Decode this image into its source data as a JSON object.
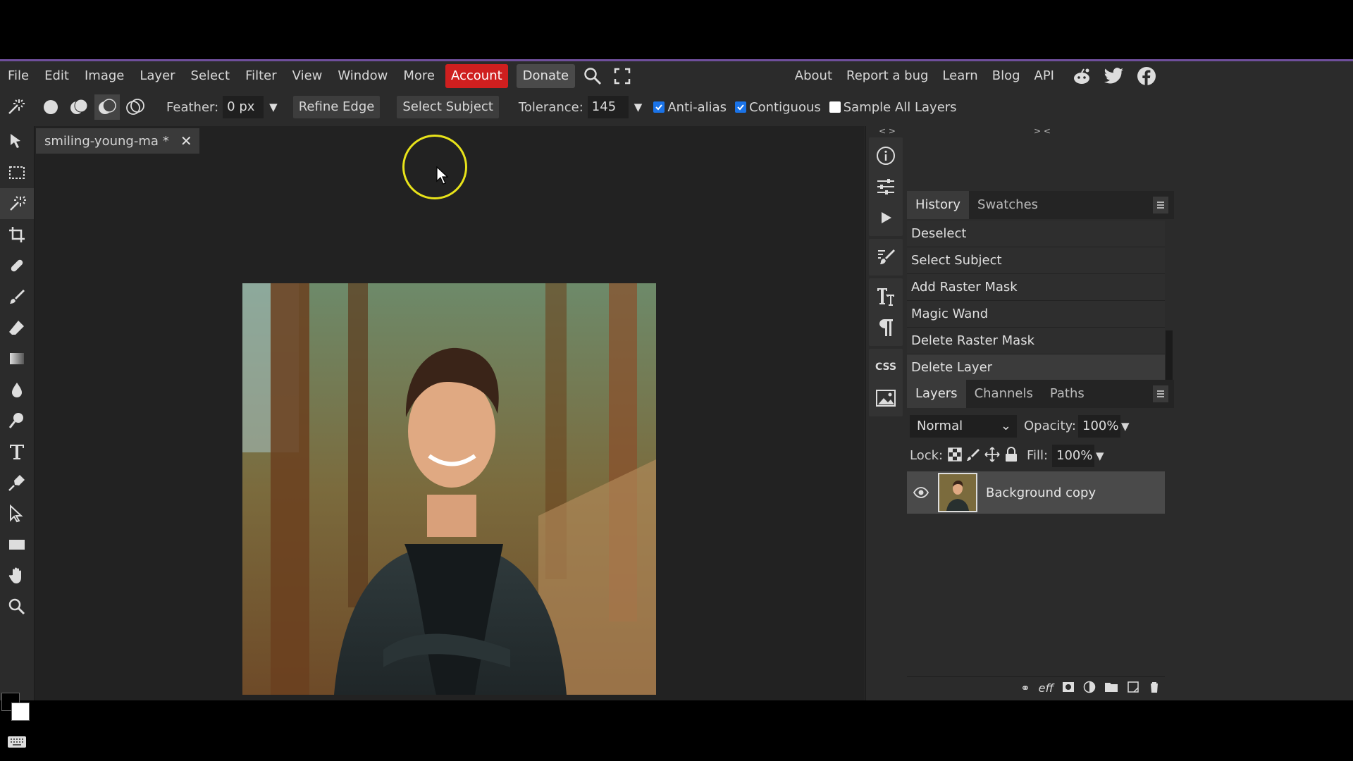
{
  "menu": {
    "items": [
      "File",
      "Edit",
      "Image",
      "Layer",
      "Select",
      "Filter",
      "View",
      "Window",
      "More"
    ],
    "account": "Account",
    "donate": "Donate",
    "right_links": [
      "About",
      "Report a bug",
      "Learn",
      "Blog",
      "API"
    ]
  },
  "options": {
    "feather_label": "Feather:",
    "feather_value": "0 px",
    "refine_edge": "Refine Edge",
    "select_subject": "Select Subject",
    "tolerance_label": "Tolerance:",
    "tolerance_value": "145",
    "anti_alias": {
      "label": "Anti-alias",
      "checked": true
    },
    "contiguous": {
      "label": "Contiguous",
      "checked": true
    },
    "sample_all": {
      "label": "Sample All Layers",
      "checked": false
    }
  },
  "document": {
    "tab_title": "smiling-young-ma",
    "modified_mark": "*"
  },
  "panels": {
    "history_tabs": [
      "History",
      "Swatches"
    ],
    "history_items": [
      "Deselect",
      "Select Subject",
      "Add Raster Mask",
      "Magic Wand",
      "Delete Raster Mask",
      "Delete Layer"
    ],
    "layers_tabs": [
      "Layers",
      "Channels",
      "Paths"
    ],
    "blend_mode": "Normal",
    "opacity_label": "Opacity:",
    "opacity_value": "100%",
    "lock_label": "Lock:",
    "fill_label": "Fill:",
    "fill_value": "100%",
    "layers": [
      {
        "name": "Background copy",
        "visible": true
      }
    ]
  },
  "colors": {
    "accent": "#6f4f9c",
    "account_bg": "#cf1f1f",
    "checkbox": "#1a73e8",
    "cursor_highlight": "#e8e31a"
  },
  "icon_col": {
    "css_label": "CSS"
  }
}
